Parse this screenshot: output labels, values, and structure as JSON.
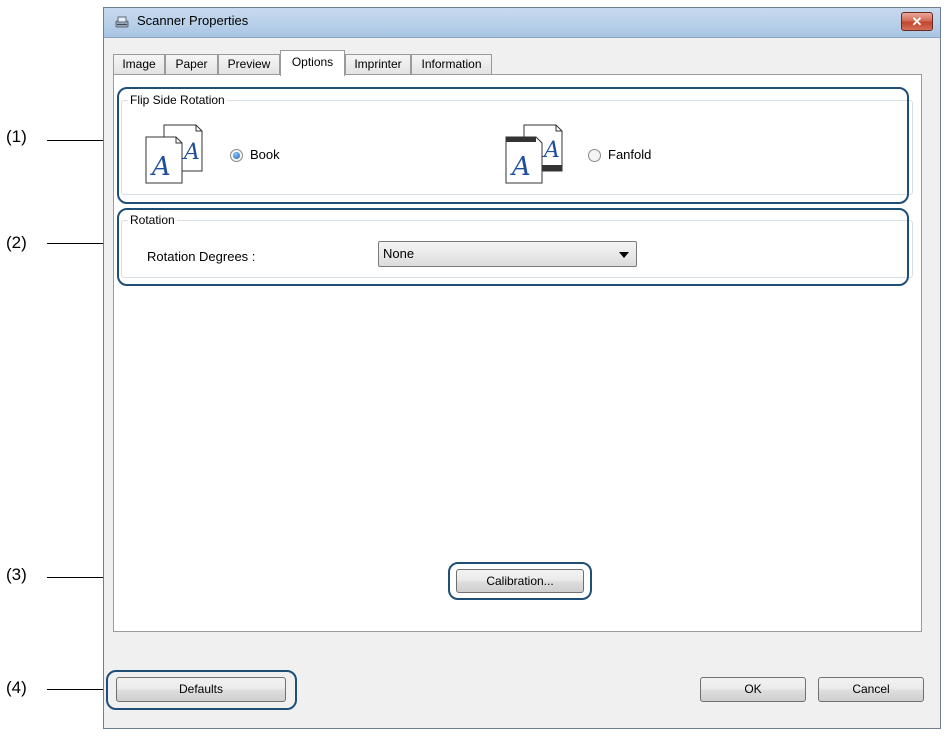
{
  "callouts": [
    "(1)",
    "(2)",
    "(3)",
    "(4)"
  ],
  "window": {
    "title": "Scanner Properties",
    "close_glyph": "✕"
  },
  "tabs": [
    {
      "label": "Image"
    },
    {
      "label": "Paper"
    },
    {
      "label": "Preview"
    },
    {
      "label": "Options",
      "active": true
    },
    {
      "label": "Imprinter"
    },
    {
      "label": "Information"
    }
  ],
  "flip_side": {
    "caption": "Flip Side Rotation",
    "book_label": "Book",
    "fanfold_label": "Fanfold",
    "selected": "Book",
    "page_glyph": "A"
  },
  "rotation": {
    "caption": "Rotation",
    "degrees_label": "Rotation Degrees :",
    "selected_value": "None"
  },
  "buttons": {
    "calibration": "Calibration...",
    "defaults": "Defaults",
    "ok": "OK",
    "cancel": "Cancel"
  },
  "colors": {
    "highlight": "#1f4e79",
    "title_bar": "#b9d1ea",
    "close": "#c2452b"
  }
}
